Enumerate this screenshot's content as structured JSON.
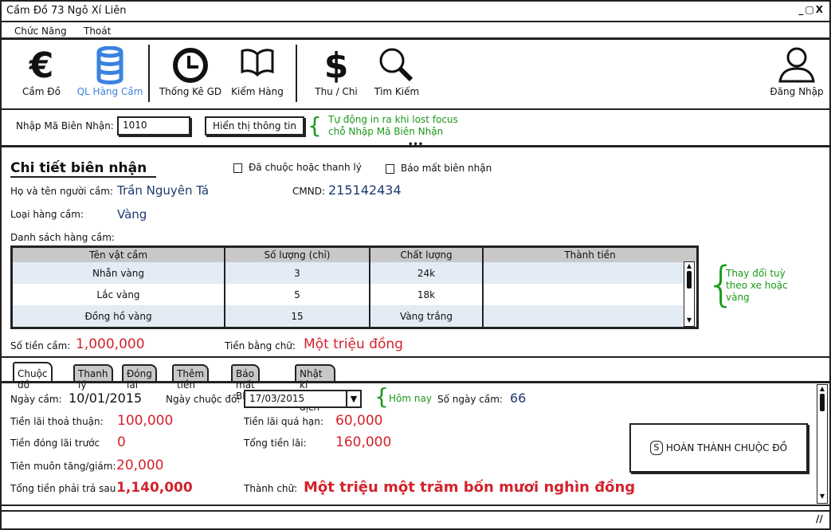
{
  "window": {
    "title": "Cầm Đồ 73 Ngô Xí Liên",
    "controls": "_▢X"
  },
  "menu": [
    "Chức Năng",
    "Thoát"
  ],
  "toolbar": {
    "items": [
      {
        "label": "Cầm Đồ",
        "icon": "euro-icon",
        "glyph": "€"
      },
      {
        "label": "QL Hàng Cầm",
        "icon": "database-icon"
      },
      {
        "label": "Thống Kê GD",
        "icon": "clock-icon"
      },
      {
        "label": "Kiểm Hàng",
        "icon": "book-icon"
      },
      {
        "label": "Thu / Chi",
        "icon": "dollar-icon",
        "glyph": "$"
      },
      {
        "label": "Tìm Kiếm",
        "icon": "search-icon"
      }
    ],
    "login": {
      "label": "Đăng Nhập",
      "icon": "user-icon"
    },
    "active_color": "#3b82e0"
  },
  "receipt": {
    "label": "Nhập Mã Biên Nhận:",
    "value": "1010",
    "button": "Hiển thị  thông tin",
    "note1": "Tự động in ra khi lost focus",
    "note2": "chỗ Nhập Mã Biên Nhận"
  },
  "details": {
    "title": "Chi tiết biên nhận",
    "cb_redeemed": "Đã chuộc hoặc thanh lý",
    "cb_lost": "Báo mất biên nhận",
    "name_label": "Họ và tên người cầm:",
    "name": "Trần Nguyên Tá",
    "id_label": "CMND:",
    "id": "215142434",
    "type_label": "Loại hàng cầm:",
    "type": "Vàng",
    "list_label": "Danh sách hàng cầm:",
    "columns": [
      "Tên vật cầm",
      "Số lượng (chỉ)",
      "Chất lượng",
      "Thành tiền"
    ],
    "rows": [
      [
        "Nhẫn vàng",
        "3",
        "24k",
        ""
      ],
      [
        "Lắc vàng",
        "5",
        "18k",
        ""
      ],
      [
        "Đồng hồ vàng",
        "15",
        "Vàng trắng",
        ""
      ]
    ],
    "note": "Thay đổi tuỳ theo xe hoặc vàng",
    "amount_label": "Số tiền cầm:",
    "amount": "1,000,000",
    "words_label": "Tiền bằng chữ:",
    "words": "Một triệu đồng"
  },
  "tabs": [
    "Chuộc đồ",
    "Thanh lý",
    "Đóng lãi",
    "Thêm tiền",
    "Báo mất BN",
    "Nhật kí giao dịch"
  ],
  "redeem": {
    "date_label": "Ngày cầm:",
    "date": "10/01/2015",
    "redeem_date_label": "Ngày chuộc đồ:",
    "redeem_date": "17/03/2015",
    "today_note": "Hôm nay",
    "days_label": "Số ngày cầm:",
    "days": "66",
    "agreed_label": "Tiền lãi thoả thuận:",
    "agreed": "100,000",
    "overdue_label": "Tiền lãi quá hạn:",
    "overdue": "60,000",
    "prepaid_label": "Tiền đóng lãi trước",
    "prepaid": "0",
    "total_interest_label": "Tổng tiền lãi:",
    "total_interest": "160,000",
    "adjust_label": "Tiên muôn tăng/giám:",
    "adjust": "20,000",
    "total_label": "Tổng tiền phải trả sau",
    "total": "1,140,000",
    "total_words_label": "Thành chữ:",
    "total_words": "Một triệu một trăm bốn mươi nghìn đồng",
    "complete_button": "HOÀN THÀNH CHUỘC ĐỒ"
  }
}
